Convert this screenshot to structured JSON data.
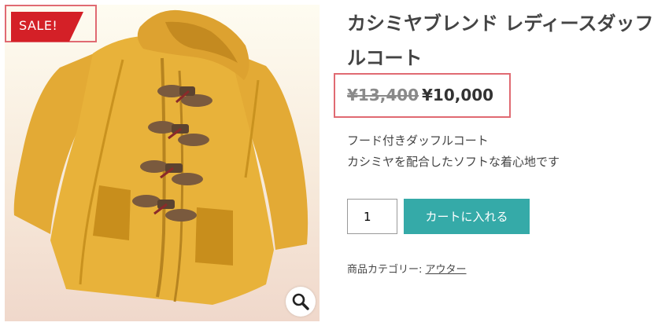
{
  "product": {
    "title": "カシミヤブレンド レディースダッフルコート",
    "sale_badge": "SALE!",
    "price_old": "¥13,400",
    "price_new": "¥10,000",
    "description": [
      "フード付きダッフルコート",
      "カシミヤを配合したソフトな着心地です"
    ],
    "quantity": "1",
    "add_to_cart_label": "カートに入れる",
    "category_label": "商品カテゴリー:",
    "category_link": "アウター"
  },
  "colors": {
    "accent": "#35aaa8",
    "sale_badge": "#d42027",
    "highlight_border": "#e06a72",
    "coat": "#e8b23a"
  },
  "icons": {
    "zoom": "magnifier-icon"
  }
}
